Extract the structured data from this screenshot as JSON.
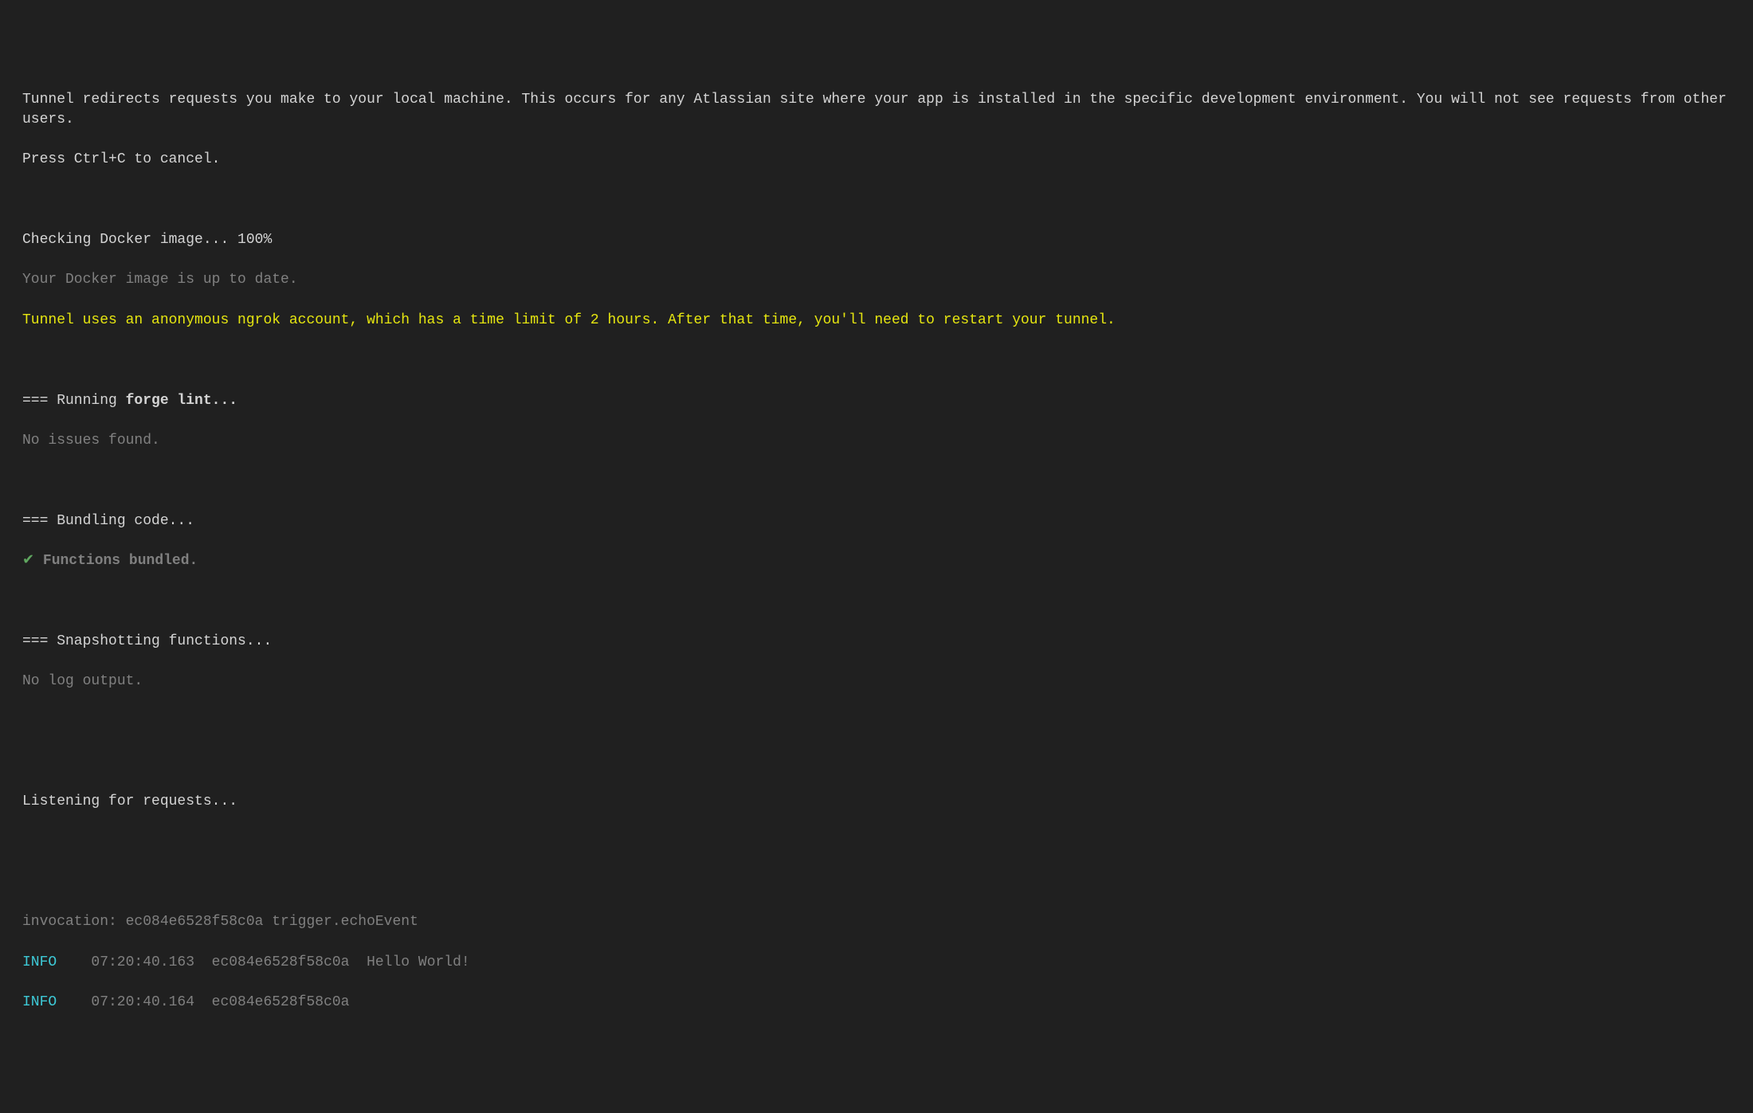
{
  "intro": {
    "line1": "Tunnel redirects requests you make to your local machine. This occurs for any Atlassian site where your app is installed in the specific development environment. You will not see requests from other users.",
    "line2": "Press Ctrl+C to cancel."
  },
  "docker": {
    "checking": "Checking Docker image... 100%",
    "uptodate": "Your Docker image is up to date."
  },
  "ngrok_warning": "Tunnel uses an anonymous ngrok account, which has a time limit of 2 hours. After that time, you'll need to restart your tunnel.",
  "lint": {
    "header_prefix": "=== Running ",
    "header_cmd": "forge lint...",
    "result": "No issues found."
  },
  "bundle": {
    "header": "=== Bundling code...",
    "check": "✔",
    "result": " Functions bundled."
  },
  "snapshot": {
    "header": "=== Snapshotting functions...",
    "result": "No log output."
  },
  "listening": "Listening for requests...",
  "invocation": "invocation: ec084e6528f58c0a trigger.echoEvent",
  "logs": [
    {
      "level": "INFO",
      "time": "07:20:40.163",
      "id": "ec084e6528f58c0a",
      "msg": "Hello World!"
    },
    {
      "level": "INFO",
      "time": "07:20:40.164",
      "id": "ec084e6528f58c0a",
      "msg": ""
    }
  ]
}
